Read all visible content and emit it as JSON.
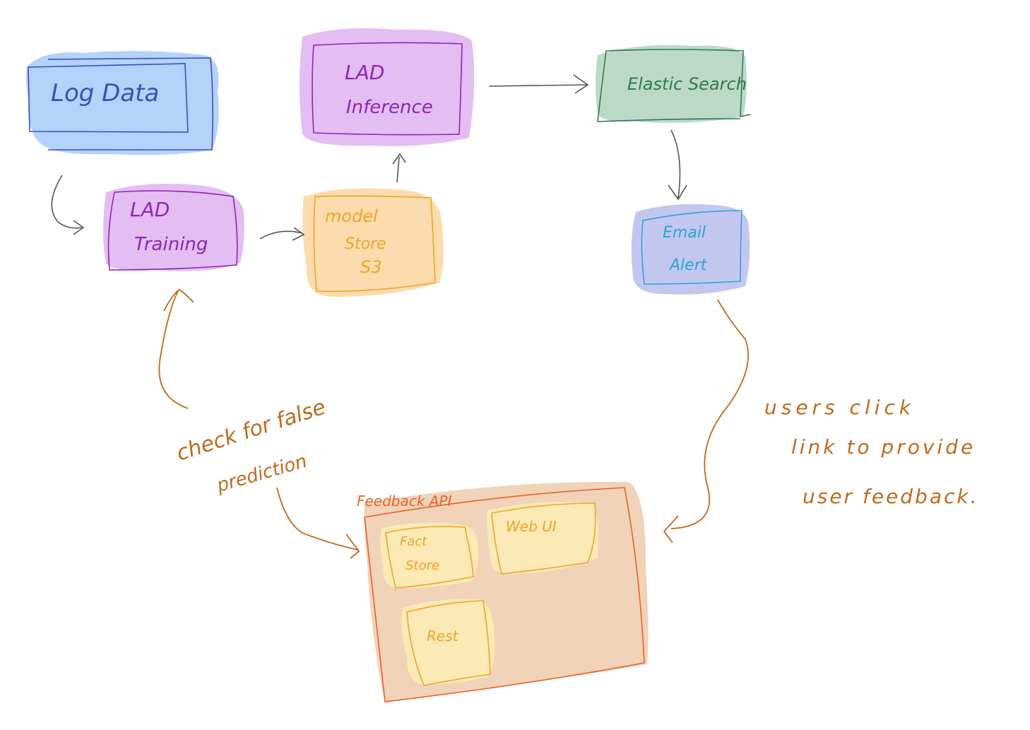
{
  "nodes": {
    "log_data": {
      "label": "Log Data"
    },
    "lad_training": {
      "line1": "LAD",
      "line2": "Training"
    },
    "model_store": {
      "line1": "model",
      "line2": "Store",
      "line3": "S3"
    },
    "lad_inference": {
      "line1": "LAD",
      "line2": "Inference"
    },
    "elastic_search": {
      "label": "Elastic Search"
    },
    "email_alert": {
      "line1": "Email",
      "line2": "Alert"
    },
    "feedback_api": {
      "label": "Feedback API",
      "fact_store": {
        "line1": "Fact",
        "line2": "Store"
      },
      "web_ui": {
        "label": "Web UI"
      },
      "rest": {
        "label": "Rest"
      }
    }
  },
  "annotations": {
    "check_false": {
      "line1": "check for false",
      "line2": "prediction"
    },
    "users_click": {
      "line1": "users click",
      "line2": "link to provide",
      "line3": "user feedback."
    }
  },
  "colors": {
    "blue_fill": "#b3d3fb",
    "blue_stroke": "#3a4fb8",
    "purple_fill": "#e4bdf2",
    "purple_stroke": "#8a26b8",
    "orange_fill": "#fcdcae",
    "orange_stroke": "#f0a326",
    "green_fill": "#bcd9c8",
    "green_stroke": "#2f7a4f",
    "periwinkle_fill": "#c3c7ee",
    "cyan_stroke": "#2aa3d8",
    "salmon_fill": "#f0d3b8",
    "salmon_stroke": "#e8612c",
    "yellow_fill": "#fbeab6",
    "annotation": "#c06a1c",
    "arrow": "#555555"
  }
}
